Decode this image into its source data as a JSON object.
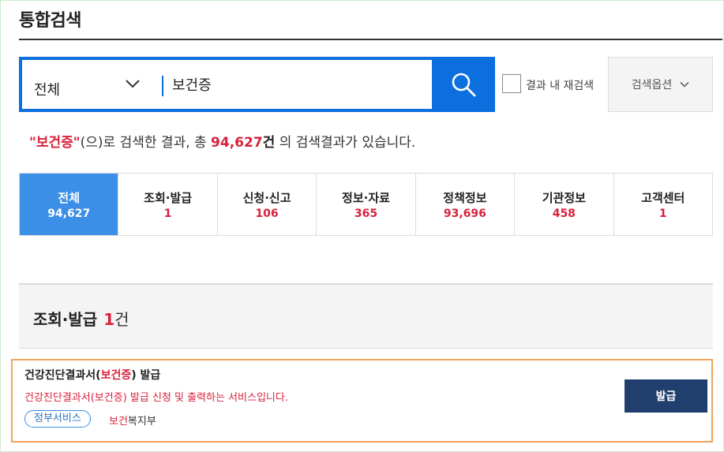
{
  "page": {
    "title": "통합검색"
  },
  "search": {
    "scope_label": "전체",
    "query": "보건증",
    "research_label": "결과 내 재검색",
    "options_label": "검색옵션"
  },
  "summary": {
    "quote_open": "\"",
    "query": "보건증",
    "quote_close": "\"",
    "text_mid": "(으)로 검색한 결과, 총 ",
    "total": "94,627",
    "unit": "건",
    "text_end": " 의 검색결과가 있습니다."
  },
  "tabs": [
    {
      "label": "전체",
      "count": "94,627",
      "active": true
    },
    {
      "label": "조회·발급",
      "count": "1"
    },
    {
      "label": "신청·신고",
      "count": "106"
    },
    {
      "label": "정보·자료",
      "count": "365"
    },
    {
      "label": "정책정보",
      "count": "93,696"
    },
    {
      "label": "기관정보",
      "count": "458"
    },
    {
      "label": "고객센터",
      "count": "1"
    }
  ],
  "section": {
    "title": "조회·발급",
    "count": "1",
    "unit": "건"
  },
  "result": {
    "title_pre": "건강진단결과서(",
    "title_hl": "보건증",
    "title_post": ") 발급",
    "desc_pre": "건강진단결과서(",
    "desc_hl": "보건증",
    "desc_post": ") 발급 신청 및 출력하는 서비스입니다.",
    "tag": "정부서비스",
    "org_hl": "보건",
    "org_rest": "복지부",
    "action_label": "발급"
  },
  "colors": {
    "accent_blue": "#0b6fe0",
    "active_tab": "#3b8fe6",
    "highlight_red": "#d8213b",
    "card_border": "#f0a35c",
    "button_navy": "#213f6e"
  },
  "icons": {
    "scope": "chevron-down-icon",
    "search": "search-icon",
    "options": "chevron-down-icon"
  }
}
